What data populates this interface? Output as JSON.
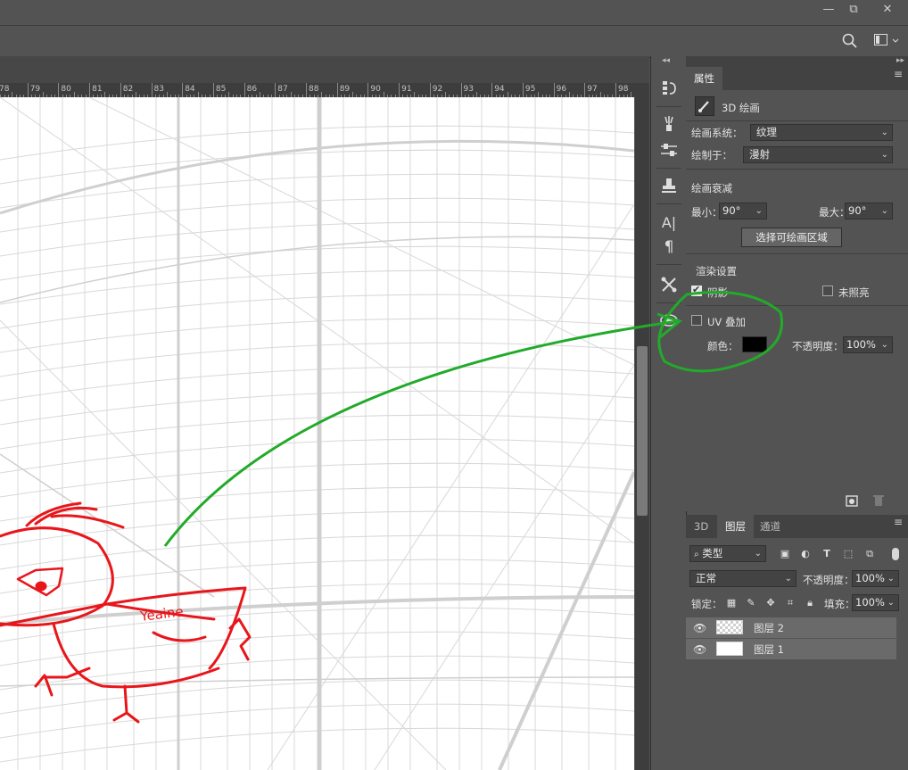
{
  "window": {
    "minimize": "—",
    "restore": "⧉",
    "close": "✕"
  },
  "optionsbar": {
    "search_icon": "search-icon",
    "workspace_icon": "workspace-icon"
  },
  "ruler": {
    "labels": [
      "78",
      "79",
      "80",
      "81",
      "82",
      "83",
      "84",
      "85",
      "86",
      "87",
      "88",
      "89",
      "90",
      "91",
      "92",
      "93",
      "94",
      "95",
      "96",
      "97",
      "98"
    ]
  },
  "canvas": {
    "sketch_text": "Yeaine"
  },
  "toolstrip": {
    "icons": [
      "history-icon",
      "brush-settings-icon",
      "adjustments-icon",
      "clone-source-icon",
      "character-icon",
      "paragraph-icon",
      "tool-presets-icon",
      "3d-materials-icon"
    ]
  },
  "properties": {
    "tab": "属性",
    "mode_label": "3D 绘画",
    "paint_system_label": "绘画系统：",
    "paint_system_value": "纹理",
    "paint_on_label": "绘制于：",
    "paint_on_value": "漫射",
    "falloff_heading": "绘画衰减",
    "min_label": "最小：",
    "min_value": "90°",
    "max_label": "最大：",
    "max_value": "90°",
    "select_area_button": "选择可绘画区域",
    "render_heading": "渲染设置",
    "shadow_label": "阴影",
    "shadow_checked": true,
    "unlit_label": "未照亮",
    "unlit_checked": false,
    "uv_overlay_label": "UV 叠加",
    "uv_overlay_checked": false,
    "color_label": "颜色：",
    "color_value": "#000000",
    "opacity_label": "不透明度：",
    "opacity_value": "100%"
  },
  "layers": {
    "tabs": [
      "3D",
      "图层",
      "通道"
    ],
    "active_tab": "图层",
    "filter_type": "类型",
    "blend_mode": "正常",
    "opacity_label": "不透明度：",
    "opacity_value": "100%",
    "lock_label": "锁定：",
    "fill_label": "填充：",
    "fill_value": "100%",
    "items": [
      {
        "name": "图层 2",
        "visible": true,
        "thumb": "transparent"
      },
      {
        "name": "图层 1",
        "visible": true,
        "thumb": "white"
      }
    ]
  },
  "colors": {
    "annotation": "#22aa2a",
    "sketch": "#e8161b",
    "panel": "#535353"
  }
}
